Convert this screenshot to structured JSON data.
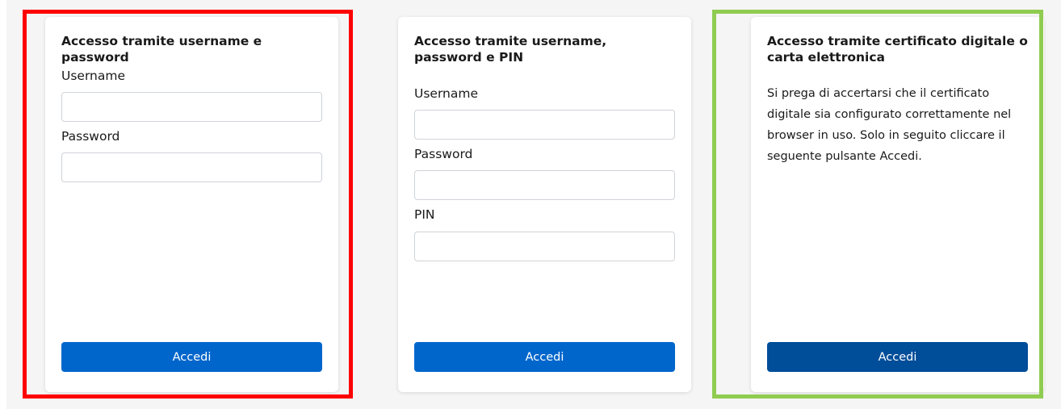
{
  "cards": [
    {
      "title": "Accesso tramite username e password",
      "fields": [
        {
          "label": "Username",
          "value": "",
          "placeholder": ""
        },
        {
          "label": "Password",
          "value": "",
          "placeholder": ""
        }
      ],
      "button_label": "Accedi"
    },
    {
      "title": "Accesso tramite username, password e PIN",
      "fields": [
        {
          "label": "Username",
          "value": "",
          "placeholder": ""
        },
        {
          "label": "Password",
          "value": "",
          "placeholder": ""
        },
        {
          "label": "PIN",
          "value": "",
          "placeholder": ""
        }
      ],
      "button_label": "Accedi"
    },
    {
      "title": "Accesso tramite certificato digitale o carta elettronica",
      "description": "Si prega di accertarsi che il certificato digitale sia configurato correttamente nel browser in uso. Solo in seguito cliccare il seguente pulsante Accedi.",
      "button_label": "Accedi"
    }
  ],
  "colors": {
    "background": "#f5f5f5",
    "button_primary": "#0066cc",
    "button_dark": "#004d99",
    "highlight_red": "#ff0000",
    "highlight_green": "#8fcc50"
  }
}
